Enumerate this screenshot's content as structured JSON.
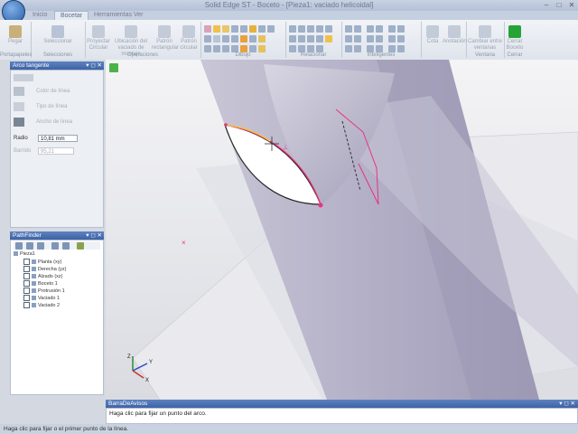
{
  "window": {
    "title": "Solid Edge ST - Boceto - [Pieza1: vaciado helicoidal]"
  },
  "tabs": [
    "Inicio",
    "Bocetar",
    "Herramientas",
    "Ver"
  ],
  "active_tab": "Bocetar",
  "ribbon": {
    "groups": [
      "Portapapeles",
      "Selecciones",
      "Operaciones",
      "Dibujo",
      "Relacionar",
      "Inteligentes",
      "",
      "Ventana",
      "Cerrar"
    ],
    "buttons": {
      "pegar": "Pegar",
      "seleccionar": "Seleccionar",
      "proyectar": "Proyectar Circular",
      "ubicacion": "Ubicación del vaciado de montaje",
      "patron_rect": "Patrón rectangular",
      "patron_circ": "Patrón circular",
      "cota": "Cota",
      "anotacion": "Anotación",
      "cambiar_ventana": "Cambiar entre ventanas",
      "cerrar_boceto": "Cerrar Boceto"
    }
  },
  "props_panel": {
    "title": "Arco tangente",
    "color_label": "Color de línea",
    "tipo_label": "Tipo de línea",
    "ancho_label": "Ancho de línea",
    "radio_label": "Radio",
    "radio_value": "10,81 mm",
    "barrido_label": "Barrido",
    "barrido_value": "95,21"
  },
  "pathfinder": {
    "title": "PathFinder",
    "root": "Pieza1",
    "items": [
      "Planta (xy)",
      "Derecha (yz)",
      "Alzado (xz)",
      "Boceto 1",
      "Protrusión 1",
      "Vaciado 1",
      "Vaciado 2"
    ]
  },
  "prompt_bar": {
    "title": "BarraDeAvisos",
    "message": "Haga clic para fijar un punto del arco."
  },
  "status": {
    "message": "Haga clic para fijar o el primer punto de la línea."
  },
  "colors": {
    "sketch": "#e8337a",
    "accent_header": "#3e63a6",
    "tube": "#a9a5bd",
    "close_button": "#26a336"
  },
  "triad": {
    "z": "Z",
    "x": "X",
    "y": "Y"
  }
}
